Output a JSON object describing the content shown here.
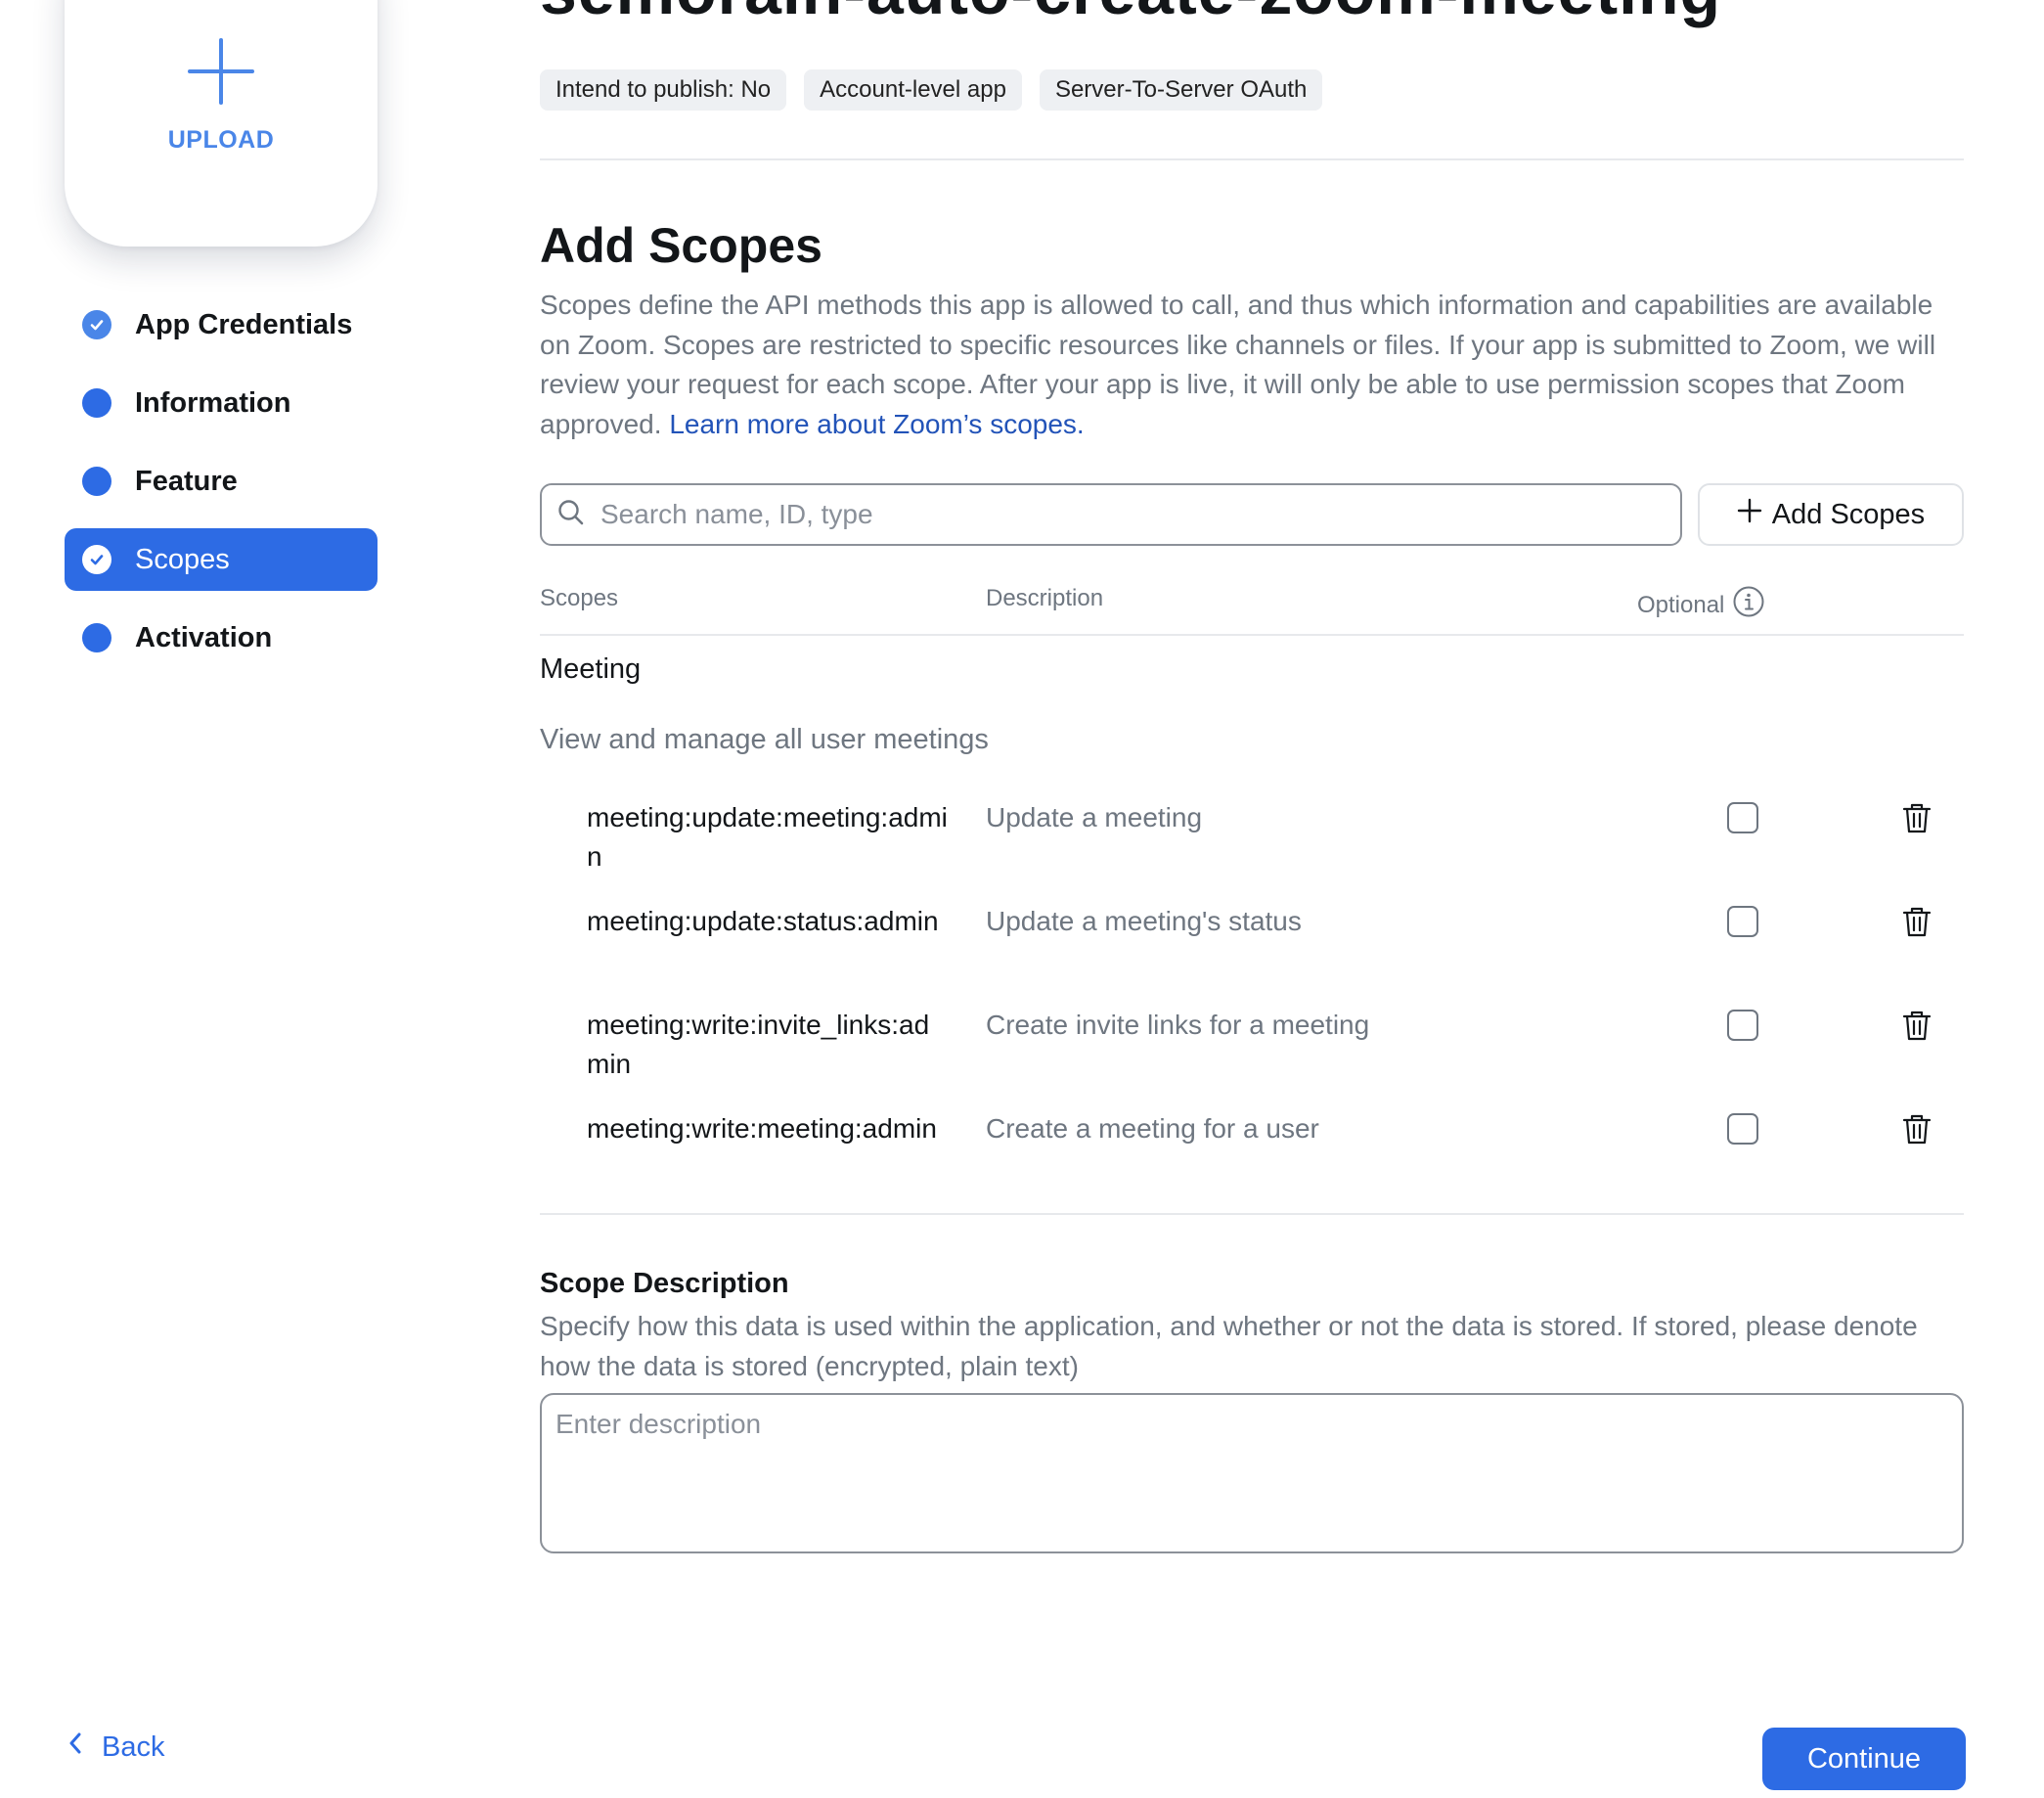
{
  "upload": {
    "label": "UPLOAD",
    "icon": "plus-icon"
  },
  "sidebar": {
    "items": [
      {
        "label": "App Credentials",
        "state": "completed"
      },
      {
        "label": "Information",
        "state": "incomplete"
      },
      {
        "label": "Feature",
        "state": "incomplete"
      },
      {
        "label": "Scopes",
        "state": "active"
      },
      {
        "label": "Activation",
        "state": "incomplete"
      }
    ]
  },
  "header": {
    "title": "semorain-auto-create-zoom-meeting",
    "chips": [
      "Intend to publish: No",
      "Account-level app",
      "Server-To-Server OAuth"
    ]
  },
  "scopes_section": {
    "title": "Add Scopes",
    "description": "Scopes define the API methods this app is allowed to call, and thus which information and capabilities are available on Zoom. Scopes are restricted to specific resources like channels or files. If your app is submitted to Zoom, we will review your request for each scope. After your app is live, it will only be able to use permission scopes that Zoom approved. ",
    "learn_more": "Learn more about Zoom’s scopes.",
    "search_placeholder": "Search name, ID, type",
    "add_button": "Add Scopes"
  },
  "table": {
    "headers": {
      "scopes": "Scopes",
      "description": "Description",
      "optional": "Optional"
    },
    "group": {
      "title": "Meeting",
      "subtitle": "View and manage all user meetings",
      "rows": [
        {
          "name": "meeting:update:meeting:admin",
          "description": "Update a meeting",
          "optional": false
        },
        {
          "name": "meeting:update:status:admin",
          "description": "Update a meeting's status",
          "optional": false
        },
        {
          "name": "meeting:write:invite_links:admin",
          "description": "Create invite links for a meeting",
          "optional": false
        },
        {
          "name": "meeting:write:meeting:admin",
          "description": "Create a meeting for a user",
          "optional": false
        }
      ]
    }
  },
  "scope_description": {
    "title": "Scope Description",
    "help": "Specify how this data is used within the application, and whether or not the data is stored. If stored, please denote how the data is stored (encrypted, plain text)",
    "placeholder": "Enter description",
    "value": ""
  },
  "footer": {
    "back": "Back",
    "continue": "Continue"
  },
  "colors": {
    "primary": "#2d6be4",
    "link": "#2253b8",
    "muted_text": "#6e7680"
  }
}
